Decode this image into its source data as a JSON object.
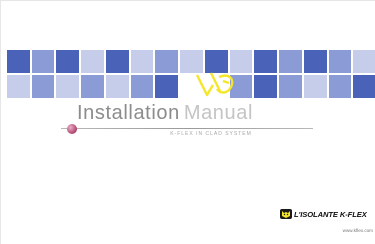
{
  "document": {
    "title_main": "Installation",
    "title_sub": "Manual",
    "system_line": "K-FLEX IN CLAD SYSTEM",
    "brand_name": "L'ISOLANTE K-FLEX",
    "brand_tagline": "· · · · · · · · · · · · · · · · · · · · · · · · ·",
    "website": "www.kflex.com"
  },
  "colors": {
    "tile_dark": "#4a62b8",
    "tile_mid": "#8a9bd6",
    "tile_light": "#c6cdeb",
    "tile_white": "#ffffff",
    "accent_yellow": "#f5e62a",
    "title_grey": "#8c8c8c",
    "bullet_magenta": "#b8507a"
  },
  "mosaic": {
    "rows": [
      [
        "dark",
        "mid",
        "dark",
        "light",
        "dark",
        "light",
        "mid",
        "light",
        "dark",
        "light",
        "dark",
        "mid",
        "dark",
        "mid",
        "light"
      ],
      [
        "light",
        "mid",
        "light",
        "mid",
        "light",
        "mid",
        "dark",
        "white",
        "white",
        "mid",
        "dark",
        "mid",
        "light",
        "mid",
        "dark"
      ]
    ]
  },
  "icons": {
    "logo_mark": "yellow-k-mark-icon",
    "bullet": "magenta-dot-icon",
    "brand_badge": "cat-head-badge-icon"
  }
}
